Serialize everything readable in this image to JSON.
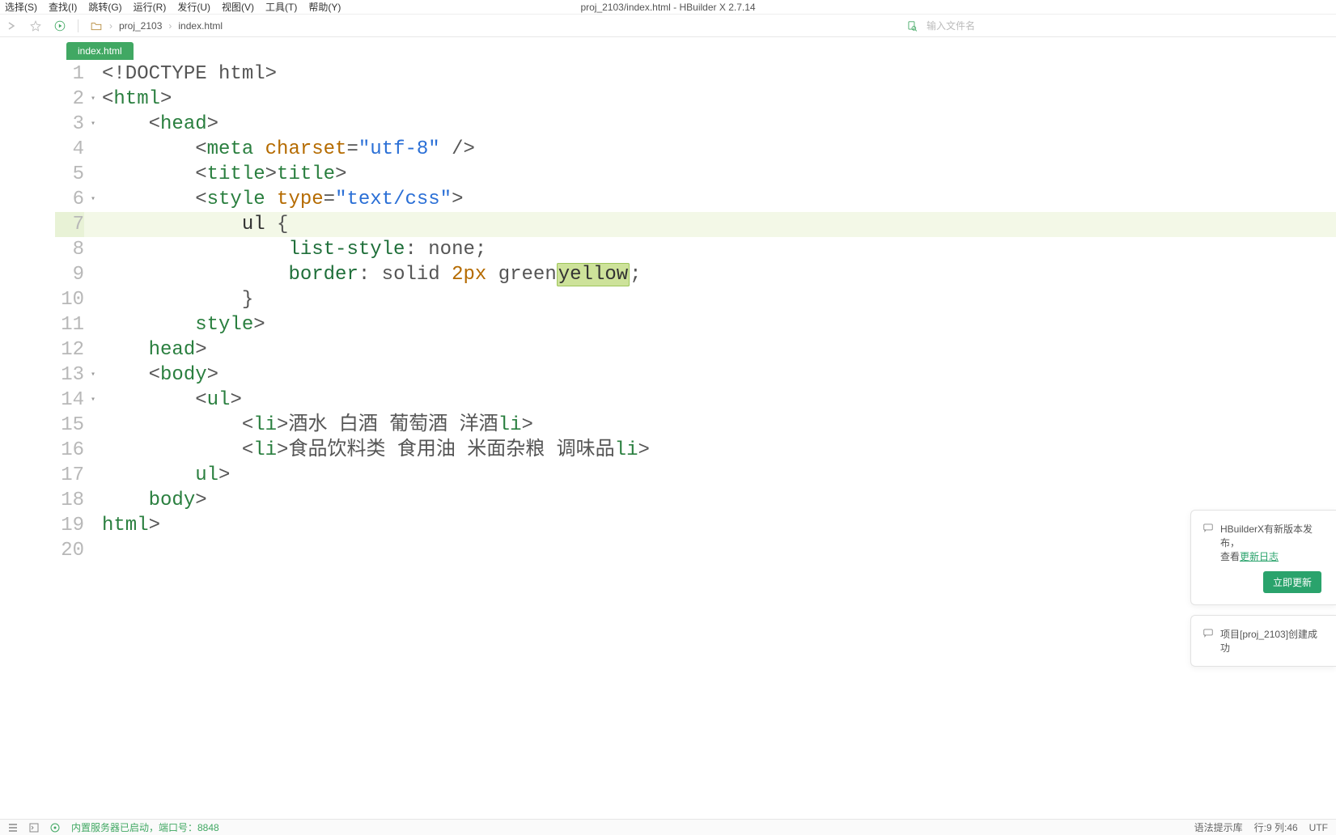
{
  "window_title": "proj_2103/index.html - HBuilder X 2.7.14",
  "menu": [
    "选择(S)",
    "查找(I)",
    "跳转(G)",
    "运行(R)",
    "发行(U)",
    "视图(V)",
    "工具(T)",
    "帮助(Y)"
  ],
  "toolbar": {
    "project": "proj_2103",
    "file": "index.html",
    "search_placeholder": "输入文件名"
  },
  "tab": {
    "label": "index.html"
  },
  "editor": {
    "cursor_line": 7,
    "lines": [
      {
        "n": 1,
        "fold": false
      },
      {
        "n": 2,
        "fold": true
      },
      {
        "n": 3,
        "fold": true
      },
      {
        "n": 4,
        "fold": false
      },
      {
        "n": 5,
        "fold": false
      },
      {
        "n": 6,
        "fold": true
      },
      {
        "n": 7,
        "fold": false
      },
      {
        "n": 8,
        "fold": false
      },
      {
        "n": 9,
        "fold": false
      },
      {
        "n": 10,
        "fold": false
      },
      {
        "n": 11,
        "fold": false
      },
      {
        "n": 12,
        "fold": false
      },
      {
        "n": 13,
        "fold": true
      },
      {
        "n": 14,
        "fold": true
      },
      {
        "n": 15,
        "fold": false
      },
      {
        "n": 16,
        "fold": false
      },
      {
        "n": 17,
        "fold": false
      },
      {
        "n": 18,
        "fold": false
      },
      {
        "n": 19,
        "fold": false
      },
      {
        "n": 20,
        "fold": false
      }
    ],
    "code_tokens": {
      "l1": {
        "t": "<!DOCTYPE html>"
      },
      "l2": {
        "tag_open": "<",
        "tag": "html",
        "tag_close": ">"
      },
      "l3": {
        "tag_open": "<",
        "tag": "head",
        "tag_close": ">"
      },
      "l4": {
        "pre": "<",
        "tag": "meta",
        "sp": " ",
        "attn": "charset",
        "eq": "=",
        "attv": "\"utf-8\"",
        "end": " />"
      },
      "l5": {
        "o": "<",
        "t1": "title",
        "c": ">",
        "o2": "</",
        "t2": "title",
        "c2": ">"
      },
      "l6": {
        "o": "<",
        "t": "style",
        "sp": " ",
        "an": "type",
        "eq": "=",
        "av": "\"text/css\"",
        "c": ">"
      },
      "l7": {
        "sel": "ul",
        "brace": " {"
      },
      "l8": {
        "p": "list-style",
        "col": ": ",
        "v": "none",
        "semi": ";"
      },
      "l9": {
        "p": "border",
        "col": ": ",
        "v1": "solid ",
        "v2": "2px",
        "sp": " ",
        "v3": "green",
        "v4": "yellow",
        "semi": ";"
      },
      "l10": {
        "brace": "}"
      },
      "l11": {
        "o": "</",
        "t": "style",
        "c": ">"
      },
      "l12": {
        "o": "</",
        "t": "head",
        "c": ">"
      },
      "l13": {
        "o": "<",
        "t": "body",
        "c": ">"
      },
      "l14": {
        "o": "<",
        "t": "ul",
        "c": ">"
      },
      "l15": {
        "o": "<",
        "t": "li",
        "c": ">",
        "txt": "酒水 白酒 葡萄酒 洋酒",
        "o2": "</",
        "t2": "li",
        "c2": ">"
      },
      "l16": {
        "o": "<",
        "t": "li",
        "c": ">",
        "txt": "食品饮料类 食用油 米面杂粮 调味品",
        "o2": "</",
        "t2": "li",
        "c2": ">"
      },
      "l17": {
        "o": "</",
        "t": "ul",
        "c": ">"
      },
      "l18": {
        "o": "</",
        "t": "body",
        "c": ">"
      },
      "l19": {
        "o": "</",
        "t": "html",
        "c": ">"
      }
    }
  },
  "notifications": {
    "update": {
      "msg_pre": "HBuilderX有新版本发布，",
      "msg_mid": "查看",
      "link": "更新日志",
      "btn": "立即更新"
    },
    "project": {
      "msg": "项目[proj_2103]创建成功"
    }
  },
  "statusbar": {
    "server": "内置服务器已启动，端口号：8848",
    "syntax": "语法提示库",
    "pos": "行:9  列:46",
    "enc": "UTF"
  }
}
